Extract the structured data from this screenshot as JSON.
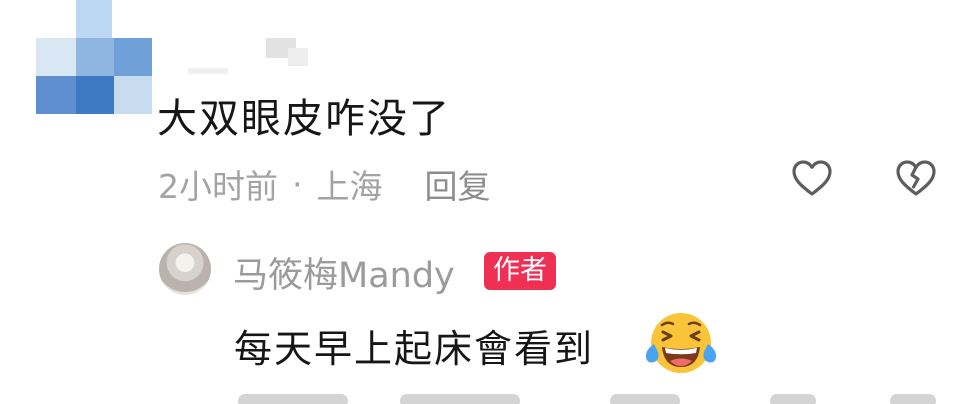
{
  "comment": {
    "text": "大双眼皮咋没了",
    "time": "2小时前",
    "separator": "·",
    "location": "上海",
    "reply_label": "回复",
    "like_icon": "heart-outline-icon",
    "dislike_icon": "broken-heart-icon"
  },
  "reply": {
    "author_name": "马筱梅Mandy",
    "author_badge": "作者",
    "text": "每天早上起床會看到",
    "emoji_icon": "laughing-crying-face-icon"
  },
  "colors": {
    "text_primary": "#161616",
    "text_secondary": "#a3a3a3",
    "badge_bg": "#f02f55",
    "emoji_yellow": "#f9c43a",
    "tear_blue": "#4aa3f0"
  }
}
